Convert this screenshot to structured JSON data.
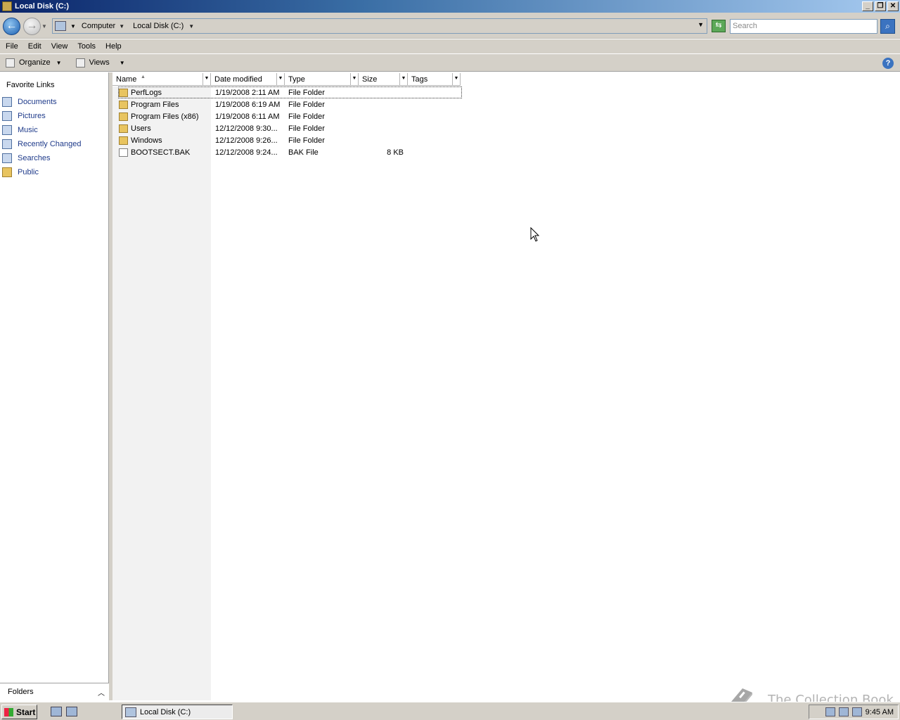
{
  "window": {
    "title": "Local Disk (C:)"
  },
  "address": {
    "breadcrumbs": [
      "Computer",
      "Local Disk (C:)"
    ],
    "search_placeholder": "Search"
  },
  "menu": [
    "File",
    "Edit",
    "View",
    "Tools",
    "Help"
  ],
  "toolbar": {
    "organize": "Organize",
    "views": "Views"
  },
  "navpane": {
    "heading": "Favorite Links",
    "links": [
      {
        "label": "Documents",
        "icon": "documents-icon"
      },
      {
        "label": "Pictures",
        "icon": "pictures-icon"
      },
      {
        "label": "Music",
        "icon": "music-icon"
      },
      {
        "label": "Recently Changed",
        "icon": "recently-changed-icon"
      },
      {
        "label": "Searches",
        "icon": "searches-icon"
      },
      {
        "label": "Public",
        "icon": "public-folder-icon"
      }
    ],
    "folders_label": "Folders"
  },
  "columns": [
    "Name",
    "Date modified",
    "Type",
    "Size",
    "Tags"
  ],
  "files": [
    {
      "name": "PerfLogs",
      "date": "1/19/2008 2:11 AM",
      "type": "File Folder",
      "size": "",
      "kind": "folder"
    },
    {
      "name": "Program Files",
      "date": "1/19/2008 6:19 AM",
      "type": "File Folder",
      "size": "",
      "kind": "folder"
    },
    {
      "name": "Program Files (x86)",
      "date": "1/19/2008 6:11 AM",
      "type": "File Folder",
      "size": "",
      "kind": "folder"
    },
    {
      "name": "Users",
      "date": "12/12/2008 9:30...",
      "type": "File Folder",
      "size": "",
      "kind": "folder"
    },
    {
      "name": "Windows",
      "date": "12/12/2008 9:26...",
      "type": "File Folder",
      "size": "",
      "kind": "folder"
    },
    {
      "name": "BOOTSECT.BAK",
      "date": "12/12/2008 9:24...",
      "type": "BAK File",
      "size": "8 KB",
      "kind": "file"
    }
  ],
  "taskbar": {
    "start": "Start",
    "task_label": "Local Disk (C:)",
    "clock": "9:45 AM"
  },
  "watermark": "The Collection Book",
  "colors": {
    "titlebar_start": "#0a246a",
    "titlebar_end": "#a6caf0",
    "chrome": "#d4d0c8",
    "link": "#1e3a8a"
  }
}
